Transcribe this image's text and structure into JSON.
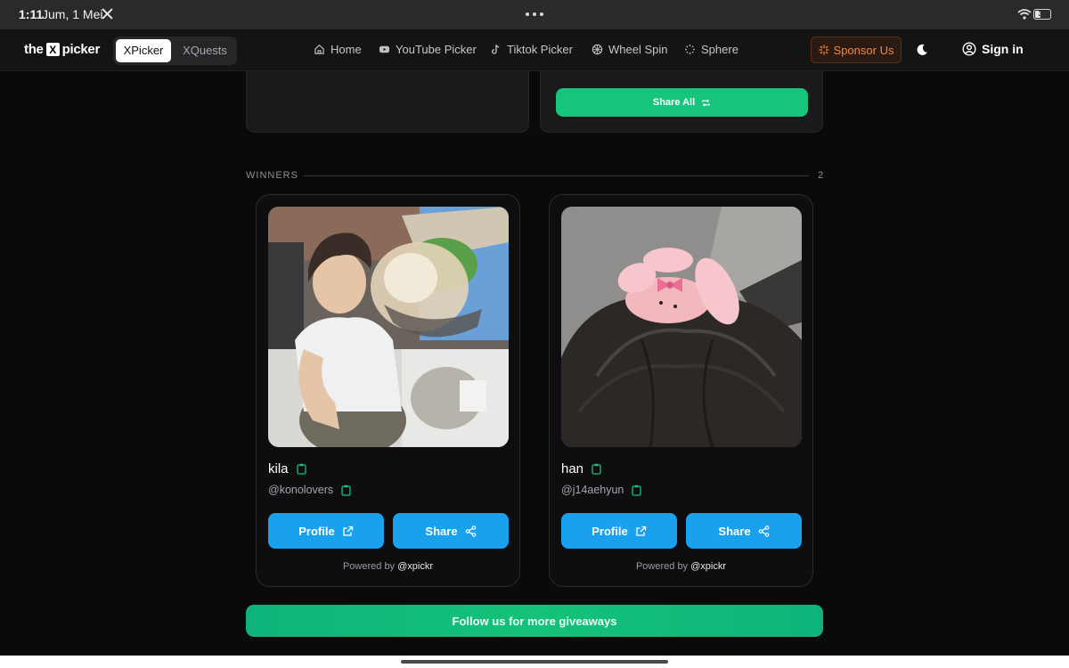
{
  "status_bar": {
    "time": "1:11",
    "date": "Jum, 1 Mei",
    "battery": "32"
  },
  "header": {
    "logo_left": "the",
    "logo_x": "X",
    "logo_right": "picker",
    "tabs": [
      {
        "label": "XPicker",
        "active": true
      },
      {
        "label": "XQuests",
        "active": false
      }
    ],
    "nav": [
      {
        "label": "Home",
        "icon": "home-icon"
      },
      {
        "label": "YouTube Picker",
        "icon": "youtube-icon"
      },
      {
        "label": "Tiktok Picker",
        "icon": "tiktok-icon"
      },
      {
        "label": "Wheel Spin",
        "icon": "wheel-icon"
      },
      {
        "label": "Sphere",
        "icon": "sphere-icon"
      }
    ],
    "sponsor_label": "Sponsor Us",
    "signin_label": "Sign in"
  },
  "top": {
    "share_all_label": "Share All"
  },
  "winners": {
    "label": "WINNERS",
    "count": "2",
    "items": [
      {
        "name": "kila",
        "handle": "@konolovers",
        "profile_label": "Profile",
        "share_label": "Share",
        "powered_prefix": "Powered by",
        "powered_handle": "@xpickr"
      },
      {
        "name": "han",
        "handle": "@j14aehyun",
        "profile_label": "Profile",
        "share_label": "Share",
        "powered_prefix": "Powered by",
        "powered_handle": "@xpickr"
      }
    ]
  },
  "footer": {
    "follow_label": "Follow us for more giveaways"
  },
  "colors": {
    "accent_blue": "#1aa1ee",
    "accent_green": "#17c47c",
    "sponsor_orange": "#f08a3e"
  }
}
